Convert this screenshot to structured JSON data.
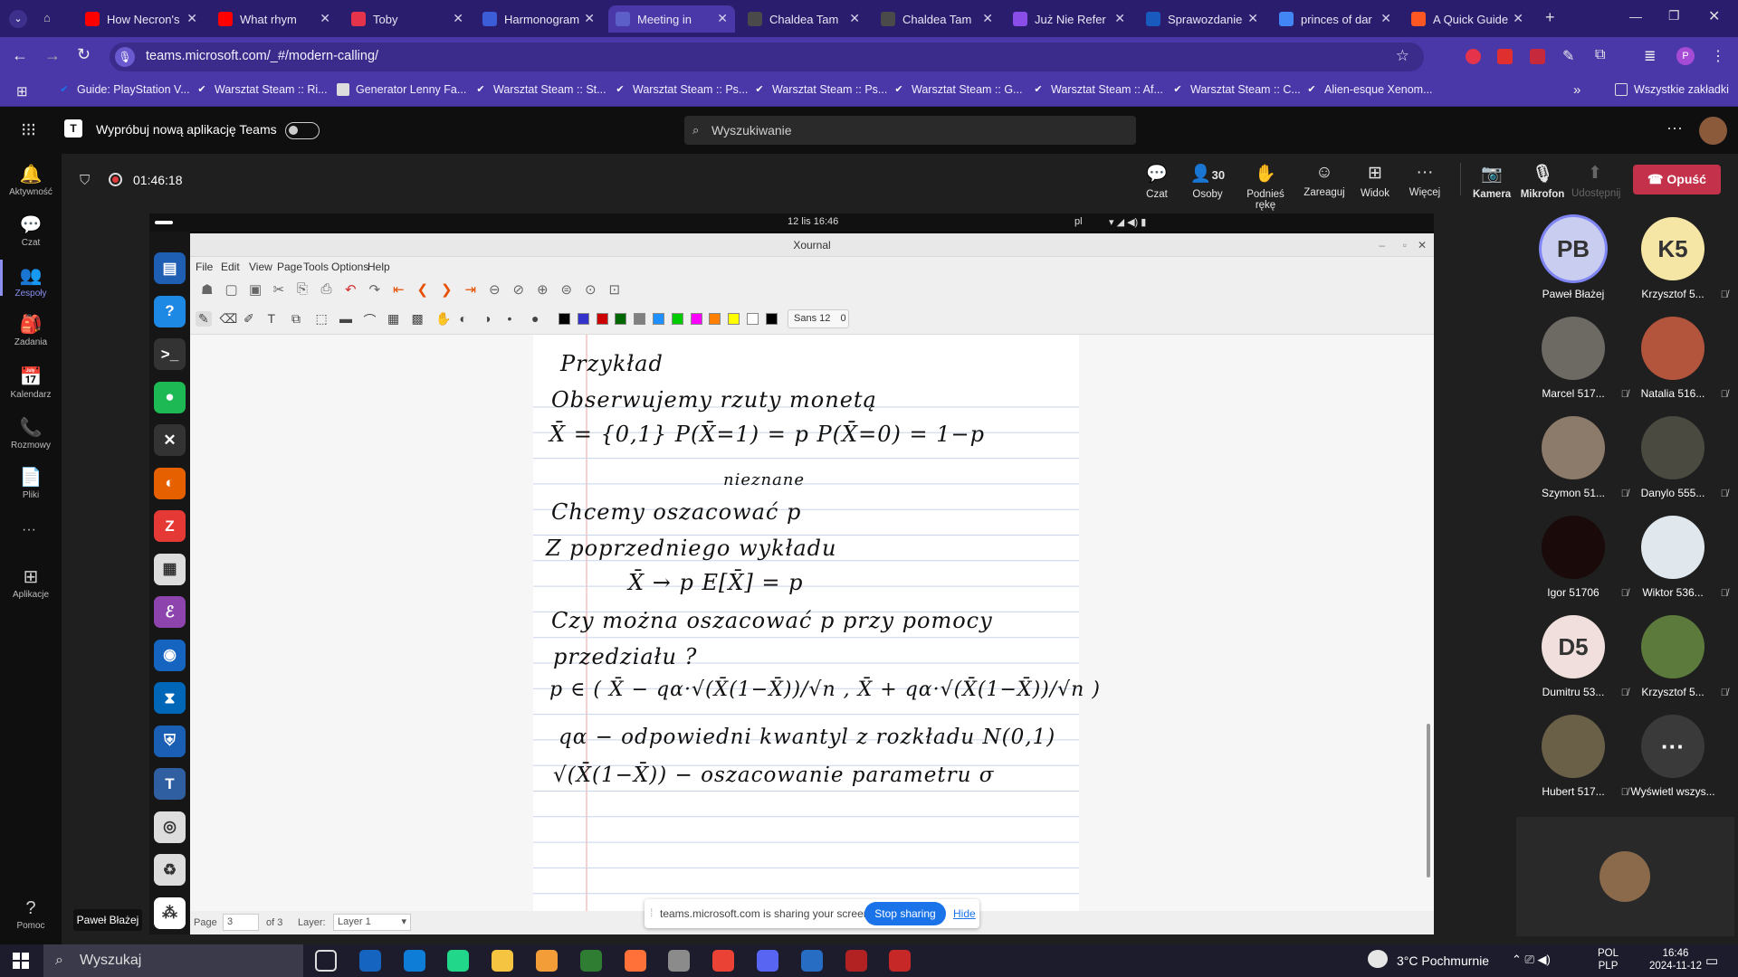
{
  "browser": {
    "tabs": [
      {
        "title": "How Necron's",
        "color": "#ff0000"
      },
      {
        "title": "What rhym",
        "color": "#ff0000"
      },
      {
        "title": "Toby",
        "color": "#e5334b"
      },
      {
        "title": "Harmonogram",
        "color": "#3b5dd8"
      },
      {
        "title": "Meeting in",
        "color": "#5b5fc7"
      },
      {
        "title": "Chaldea Tam",
        "color": "#4a4a4a"
      },
      {
        "title": "Chaldea Tam",
        "color": "#4a4a4a"
      },
      {
        "title": "Już Nie Refer",
        "color": "#8a4de8"
      },
      {
        "title": "Sprawozdanie",
        "color": "#185abd"
      },
      {
        "title": "princes of dar",
        "color": "#4285f4"
      },
      {
        "title": "A Quick Guide",
        "color": "#ff5722"
      }
    ],
    "url": "teams.microsoft.com/_#/modern-calling/",
    "bookmarks": [
      "Guide: PlayStation V...",
      "Warsztat Steam :: Ri...",
      "Generator Lenny Fa...",
      "Warsztat Steam :: St...",
      "Warsztat Steam :: Ps...",
      "Warsztat Steam :: Ps...",
      "Warsztat Steam :: G...",
      "Warsztat Steam :: Af...",
      "Warsztat Steam :: C...",
      "Alien-esque Xenom..."
    ],
    "all_bookmarks": "Wszystkie zakładki",
    "profile_initial": "P"
  },
  "teams": {
    "try_new": "Wypróbuj nową aplikację Teams",
    "search_placeholder": "Wyszukiwanie",
    "rail": [
      "Aktywność",
      "Czat",
      "Zespoły",
      "Zadania",
      "Kalendarz",
      "Rozmowy",
      "Pliki",
      "Aplikacje",
      "Pomoc"
    ],
    "timer": "01:46:18",
    "controls": {
      "chat": "Czat",
      "people": "Osoby",
      "people_count": "30",
      "raise": "Podnieś rękę",
      "react": "Zareaguj",
      "view": "Widok",
      "more": "Więcej",
      "camera": "Kamera",
      "mic": "Mikrofon",
      "share": "Udostępnij",
      "leave": "Opuść"
    },
    "presenter_tooltip": "Paweł Błażej",
    "participants": [
      {
        "name": "Paweł Błażej",
        "initials": "PB",
        "color": "#c9cdf0"
      },
      {
        "name": "Krzysztof 5...",
        "initials": "K5",
        "color": "#f6e6a6"
      },
      {
        "name": "Marcel 517...",
        "initials": "",
        "color": "#6d6a64"
      },
      {
        "name": "Natalia 516...",
        "initials": "",
        "color": "#b3553d"
      },
      {
        "name": "Szymon 51...",
        "initials": "",
        "color": "#8c7a6a"
      },
      {
        "name": "Danylo 555...",
        "initials": "",
        "color": "#4a4a40"
      },
      {
        "name": "Igor 51706",
        "initials": "",
        "color": "#1a0a0a"
      },
      {
        "name": "Wiktor 536...",
        "initials": "",
        "color": "#e0e8ee"
      },
      {
        "name": "Dumitru 53...",
        "initials": "D5",
        "color": "#f0dfdc"
      },
      {
        "name": "Krzysztof 5...",
        "initials": "",
        "color": "#5c7a3c"
      },
      {
        "name": "Hubert 517...",
        "initials": "",
        "color": "#6a6048"
      },
      {
        "name": "Wyświetl wszys...",
        "initials": "···",
        "color": "#3a3a3a"
      }
    ]
  },
  "shared": {
    "top_time": "12 lis 16:46",
    "top_lang": "pl",
    "window_title": "Xournal",
    "menu": [
      "File",
      "Edit",
      "View",
      "Page",
      "Tools",
      "Options",
      "Help"
    ],
    "font_label": "Sans 12",
    "font_size": "0",
    "palette": [
      "#000000",
      "#3333cc",
      "#cc0000",
      "#006600",
      "#808080",
      "#1e90ff",
      "#00cc00",
      "#ff00ff",
      "#ff8000",
      "#ffff00",
      "#ffffff",
      "#000000"
    ],
    "page_label": "Page",
    "page_value": "3",
    "page_of": "of 3",
    "layer_label": "Layer:",
    "layer_value": "Layer 1",
    "sharing_msg": "teams.microsoft.com is sharing your screen.",
    "stop_sharing": "Stop sharing",
    "hide": "Hide",
    "notes": [
      "Przykład",
      "Obserwujemy rzuty monetą",
      "X̄ = {0,1}   P(X̄=1) = p   P(X̄=0) = 1−p",
      "nieznane",
      "Chcemy oszacować p",
      "Z poprzedniego wykładu",
      "X̄ → p        E[X̄] = p",
      "Czy można oszacować p przy pomocy",
      "przedziału ?",
      "p ∈ ( X̄ − qα·√(X̄(1−X̄))/√n ,  X̄ + qα·√(X̄(1−X̄))/√n )",
      "qα − odpowiedni kwantyl z rozkładu N(0,1)",
      "√(X̄(1−X̄)) − oszacowanie parametru σ"
    ]
  },
  "taskbar": {
    "search": "Wyszukaj",
    "weather": "3°C  Pochmurnie",
    "lang1": "POL",
    "lang2": "PLP",
    "time": "16:46",
    "date": "2024-11-12"
  }
}
